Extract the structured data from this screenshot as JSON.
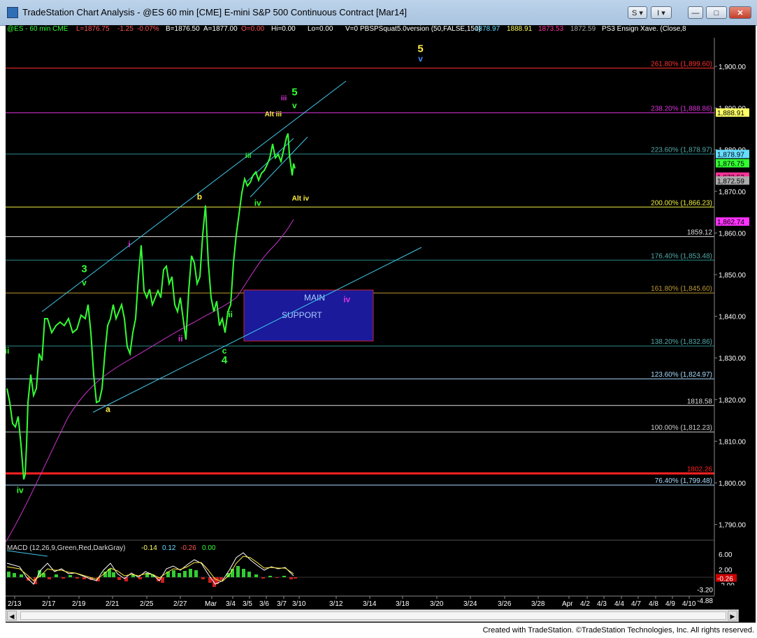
{
  "window": {
    "title": "TradeStation Chart Analysis - @ES 60 min [CME] E-mini S&P 500 Continuous Contract [Mar14]",
    "buttons": {
      "s": "S",
      "i": "I",
      "minimize": "—",
      "maximize": "□",
      "close": "✕"
    }
  },
  "status_bar": {
    "symbol": "@ES - 60 min  CME",
    "last": "L=1876.75",
    "change": "-1.25",
    "change_pct": "-0.07%",
    "bid": "B=1876.50",
    "ask": "A=1877.00",
    "open": "O=0.00",
    "hi": "Hi=0.00",
    "lo": "Lo=0.00",
    "vol": "V=0",
    "study": "PBSPSquat5.0version (50,FALSE,150)",
    "v1": "1878.97",
    "v2": "1888.91",
    "v3": "1873.53",
    "v4": "1872.59",
    "study2": "PS3 Ensign Xave. (Close,8"
  },
  "colors": {
    "bg": "#000000",
    "price": "#33ff33",
    "channel": "#40c8e8",
    "ma": "#cc33cc",
    "red": "#ff2020",
    "yellow": "#ffee44",
    "magenta": "#dd33dd",
    "blue_box": "#1a1a9a"
  },
  "price_axis": {
    "labels": [
      "1,900.00",
      "1,890.00",
      "1,880.00",
      "1,870.00",
      "1,860.00",
      "1,850.00",
      "1,840.00",
      "1,830.00",
      "1,820.00",
      "1,810.00",
      "1,800.00",
      "1,790.00"
    ]
  },
  "price_badges": [
    {
      "text": "1,888.91",
      "bg": "#ffff66",
      "fg": "#000000",
      "price": 1888.91
    },
    {
      "text": "1,878.97",
      "bg": "#66ddff",
      "fg": "#000000",
      "price": 1878.97
    },
    {
      "text": "1,876.75",
      "bg": "#33ff33",
      "fg": "#000000",
      "price": 1876.75
    },
    {
      "text": "1,873.53",
      "bg": "#ff3399",
      "fg": "#000000",
      "price": 1873.53
    },
    {
      "text": "1,872.59",
      "bg": "#aaaaaa",
      "fg": "#000000",
      "price": 1872.59
    },
    {
      "text": "1,862.74",
      "bg": "#ff33ff",
      "fg": "#000000",
      "price": 1862.74
    }
  ],
  "fib_lines": [
    {
      "label": "261.80% (1,899.60)",
      "price": 1899.6,
      "color": "#ff3030"
    },
    {
      "label": "238.20% (1,888.86)",
      "price": 1888.86,
      "color": "#dd33dd"
    },
    {
      "label": "223.60% (1,878.97)",
      "price": 1878.97,
      "color": "#2a8a8a"
    },
    {
      "label": "200.00% (1,866.23)",
      "price": 1866.23,
      "color": "#eeee44"
    },
    {
      "label": "1859.12",
      "price": 1859.12,
      "color": "#dddddd"
    },
    {
      "label": "176.40% (1,853.48)",
      "price": 1853.48,
      "color": "#2a8a8a"
    },
    {
      "label": "161.80% (1,845.60)",
      "price": 1845.6,
      "color": "#bb9933"
    },
    {
      "label": "138.20% (1,832.86)",
      "price": 1832.86,
      "color": "#2a8a8a"
    },
    {
      "label": "123.60% (1,824.97)",
      "price": 1824.97,
      "color": "#aaddff"
    },
    {
      "label": "1818.58",
      "price": 1818.58,
      "color": "#dddddd"
    },
    {
      "label": "100.00% (1,812.23)",
      "price": 1812.23,
      "color": "#cccccc"
    },
    {
      "label": "1802.26",
      "price": 1802.26,
      "color": "#ff2020"
    },
    {
      "label": "76.40% (1,799.48)",
      "price": 1799.48,
      "color": "#aaddff"
    }
  ],
  "wave_labels": [
    {
      "text": "5",
      "color": "#ffee44",
      "price": 1903.4,
      "day": 34.8
    },
    {
      "text": "v",
      "color": "#4488ff",
      "price": 1901.2,
      "day": 34.8
    },
    {
      "text": "5",
      "color": "#33ff33",
      "price": 1893.0,
      "day": 24.2
    },
    {
      "text": "iii",
      "color": "#dd33dd",
      "price": 1891.9,
      "day": 23.3
    },
    {
      "text": "v",
      "color": "#33ff33",
      "price": 1889.9,
      "day": 24.2
    },
    {
      "text": "Alt iii",
      "color": "#ffee44",
      "price": 1888.0,
      "day": 22.4
    },
    {
      "text": "iii",
      "color": "#33ff33",
      "price": 1878.0,
      "day": 20.3
    },
    {
      "text": "b",
      "color": "#ffee44",
      "price": 1868.0,
      "day": 16.2
    },
    {
      "text": "iv",
      "color": "#33ff33",
      "price": 1866.5,
      "day": 21.1
    },
    {
      "text": "Alt iv",
      "color": "#ffee44",
      "price": 1867.8,
      "day": 24.7
    },
    {
      "text": "i",
      "color": "#dd33dd",
      "price": 1856.6,
      "day": 10.3
    },
    {
      "text": "3",
      "color": "#33ff33",
      "price": 1850.6,
      "day": 6.5
    },
    {
      "text": "v",
      "color": "#33ff33",
      "price": 1847.4,
      "day": 6.5
    },
    {
      "text": "iv",
      "color": "#dd33dd",
      "price": 1843.4,
      "day": 28.6
    },
    {
      "text": "ii",
      "color": "#33ff33",
      "price": 1839.8,
      "day": 18.8
    },
    {
      "text": "ii",
      "color": "#dd33dd",
      "price": 1834.0,
      "day": 14.6
    },
    {
      "text": "c",
      "color": "#33ff33",
      "price": 1831.0,
      "day": 18.3
    },
    {
      "text": "4",
      "color": "#33ff33",
      "price": 1828.7,
      "day": 18.3
    },
    {
      "text": "ii",
      "color": "#33ff33",
      "price": 1831.0,
      "day": 0.0
    },
    {
      "text": "a",
      "color": "#ffee44",
      "price": 1817.0,
      "day": 8.5
    },
    {
      "text": "iv",
      "color": "#33ff33",
      "price": 1797.6,
      "day": 1.1
    }
  ],
  "box": {
    "line1": "MAIN",
    "line2": "SUPPORT"
  },
  "macd": {
    "title": "MACD (12,26,9,Green,Red,DarkGray)",
    "v1": "-0.14",
    "v2": "0.12",
    "v3": "-0.26",
    "v4": "0.00",
    "axis": [
      "6.00",
      "2.00",
      "-2.00"
    ],
    "badges": [
      {
        "text": "-0.26",
        "bg": "#cc0000",
        "value": -0.26
      },
      {
        "text": "-3.20",
        "bg": "#000000",
        "value": -3.2
      },
      {
        "text": "-4.88",
        "bg": "#000000",
        "value": -4.88
      }
    ]
  },
  "date_axis": [
    "2/13",
    "2/17",
    "2/19",
    "2/21",
    "2/25",
    "2/27",
    "Mar",
    "3/4",
    "3/5",
    "3/6",
    "3/7",
    "3/10",
    "3/12",
    "3/14",
    "3/18",
    "3/20",
    "3/24",
    "3/26",
    "3/28",
    "Apr",
    "4/2",
    "4/3",
    "4/4",
    "4/7",
    "4/8",
    "4/9",
    "4/10"
  ],
  "footer": "Created with TradeStation. ©TradeStation Technologies, Inc. All rights reserved."
}
